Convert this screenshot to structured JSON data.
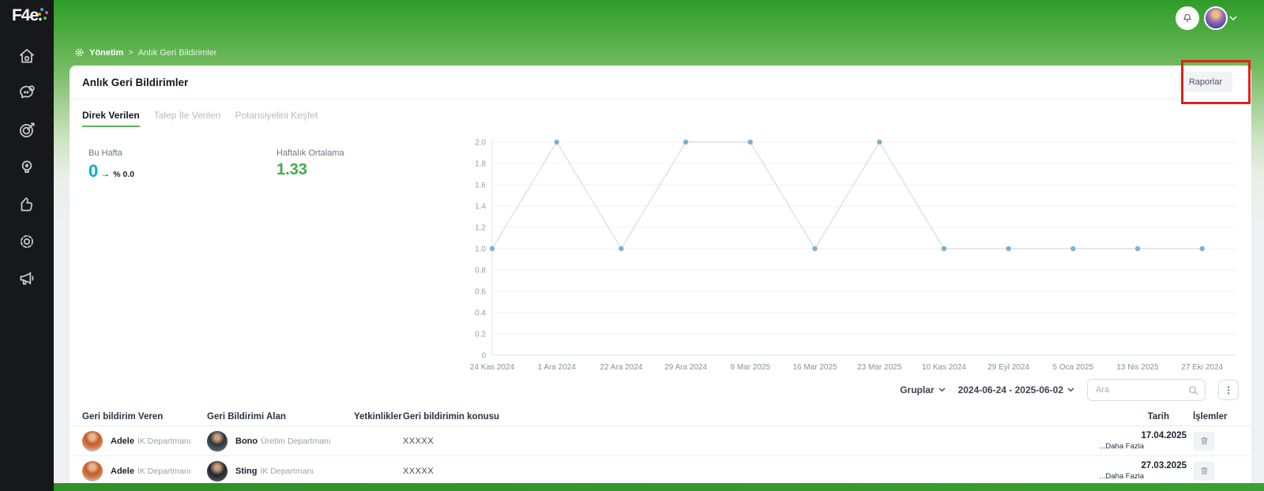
{
  "brand": {
    "logo_text": "F4e."
  },
  "sidebar": {
    "items": [
      "home-icon",
      "chat-icon",
      "target-icon",
      "idea-icon",
      "like-icon",
      "settings-icon",
      "announcement-icon"
    ]
  },
  "topbar": {
    "bell_icon": "bell-icon",
    "avatar": "user-avatar"
  },
  "breadcrumb": {
    "items": [
      "Yönetim",
      "Anlık Geri Bildirimler"
    ],
    "separator": ">"
  },
  "page": {
    "title": "Anlık Geri Bildirimler",
    "reports_button": "Raporlar"
  },
  "annotation_box": {
    "target": "reports-button",
    "color": "#e02318"
  },
  "tabs": [
    {
      "label": "Direk Verilen",
      "active": true
    },
    {
      "label": "Talep İle Verilen",
      "active": false
    },
    {
      "label": "Potansiyelini Keşfet",
      "active": false
    }
  ],
  "stats": {
    "this_week": {
      "label": "Bu Hafta",
      "value": "0",
      "arrow": "→",
      "delta": "% 0.0",
      "value_color": "#00aec9"
    },
    "weekly_avg": {
      "label": "Haftalık Ortalama",
      "value": "1.33",
      "value_color": "#3cb043"
    }
  },
  "chart_data": {
    "type": "line",
    "x": [
      "24 Kas 2024",
      "1 Ara 2024",
      "22 Ara 2024",
      "29 Ara 2024",
      "9 Mar 2025",
      "16 Mar 2025",
      "23 Mar 2025",
      "10 Kas 2024",
      "29 Eyl 2024",
      "5 Oca 2025",
      "13 Nis 2025",
      "27 Eki 2024"
    ],
    "values": [
      1,
      2,
      1,
      2,
      2,
      1,
      2,
      1,
      1,
      1,
      1,
      1
    ],
    "ylim": [
      0,
      2
    ],
    "yticks": [
      "2.0",
      "1.8",
      "1.6",
      "1.4",
      "1.2",
      "1.0",
      "0.8",
      "0.6",
      "0.4",
      "0.2",
      "0"
    ],
    "grid": true,
    "legend": "none",
    "line_color": "#dce1e6",
    "point_color": "#7fb0cf",
    "title": "",
    "xlabel": "",
    "ylabel": ""
  },
  "filters": {
    "group_dropdown": "Gruplar",
    "date_range": "2024-06-24 - 2025-06-02",
    "search_placeholder": "Ara",
    "kebab": "⋮"
  },
  "table": {
    "columns": [
      "Geri bildirim Veren",
      "Geri Bildirimi Alan",
      "Yetkinlikler",
      "Geri bildirimin konusu",
      "Tarih",
      "İşlemler"
    ],
    "rows": [
      {
        "giver": {
          "name": "Adele",
          "department": "İK Departmanı"
        },
        "receiver": {
          "name": "Bono",
          "department": "Üretim Departmanı"
        },
        "competencies": "",
        "subject": "XXXXX",
        "more": "...Daha Fazla",
        "date": "17.04.2025"
      },
      {
        "giver": {
          "name": "Adele",
          "department": "İK Departmanı"
        },
        "receiver": {
          "name": "Sting",
          "department": "İK Departmanı"
        },
        "competencies": "",
        "subject": "XXXXX",
        "more": "...Daha Fazla",
        "date": "27.03.2025"
      }
    ]
  }
}
